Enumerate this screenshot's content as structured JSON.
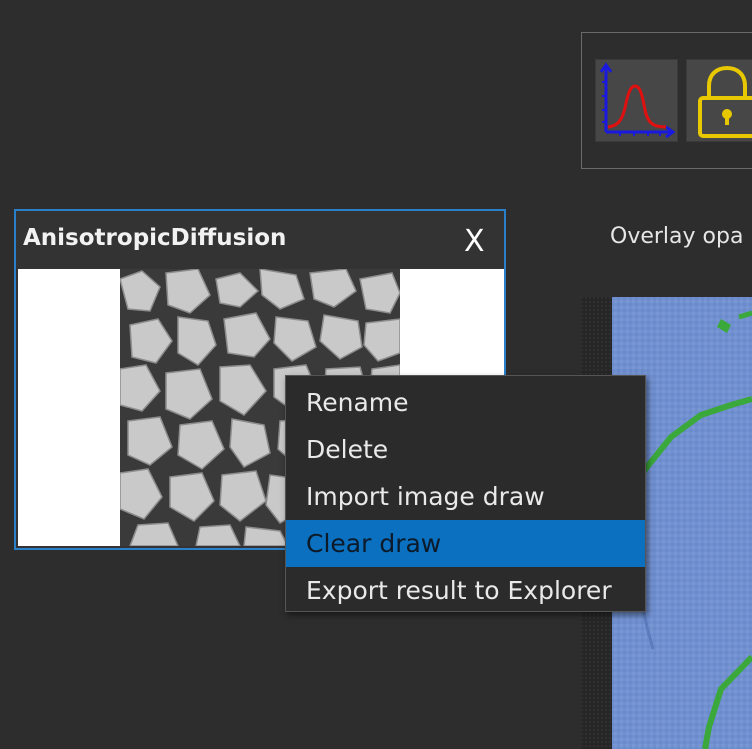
{
  "toolbar": {
    "buttons": [
      {
        "icon": "histogram-curve-icon"
      },
      {
        "icon": "padlock-icon"
      }
    ],
    "colors": {
      "axis": "#1a1adf",
      "curve": "#e01010",
      "lock": "#e8c800"
    }
  },
  "overlay": {
    "label": "Overlay opa"
  },
  "card": {
    "title": "AnisotropicDiffusion",
    "close_label": "X",
    "border_color": "#2a7fc9"
  },
  "context_menu": {
    "items": [
      {
        "label": "Rename",
        "active": false
      },
      {
        "label": "Delete",
        "active": false
      },
      {
        "label": "Import image draw",
        "active": false
      },
      {
        "label": "Clear draw",
        "active": true
      },
      {
        "label": "Export result to Explorer",
        "active": false
      }
    ],
    "highlight_color": "#0a70bf"
  },
  "viewer": {
    "fill_color": "#6f8fcf",
    "edge_color": "#3aa83a"
  }
}
